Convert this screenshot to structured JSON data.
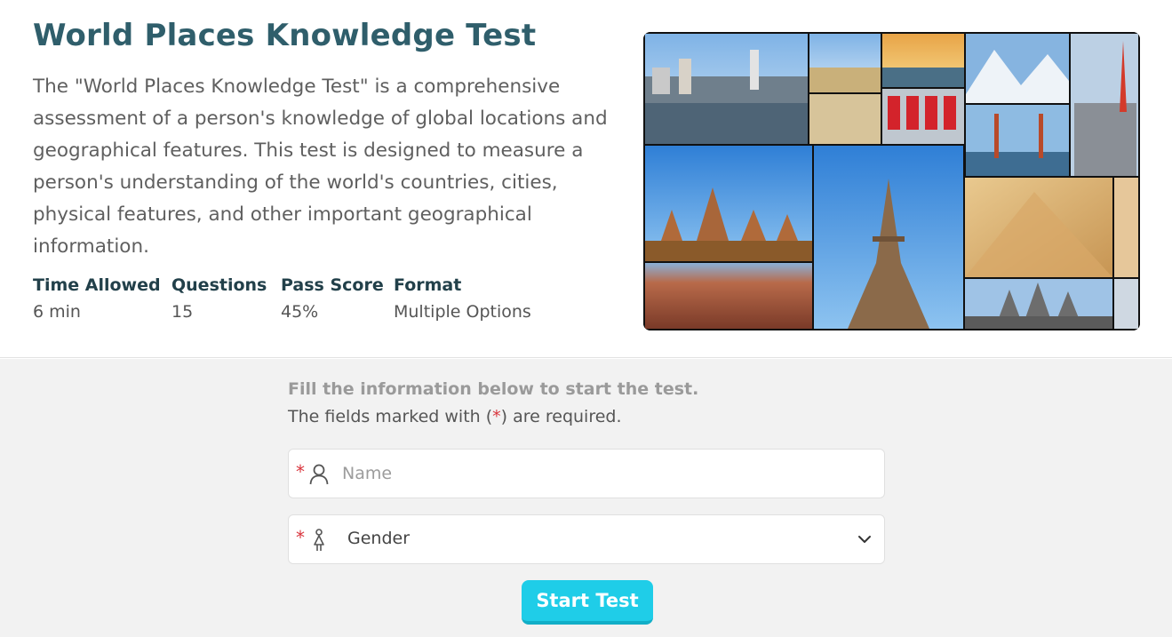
{
  "header": {
    "title": "World Places Knowledge Test",
    "description": "The \"World Places Knowledge Test\" is a comprehensive assessment of a person's knowledge of global locations and geographical features. This test is designed to measure a person's understanding of the world's countries, cities, physical features, and other important geographical information."
  },
  "stats": [
    {
      "label": "Time Allowed",
      "value": "6 min"
    },
    {
      "label": "Questions",
      "value": "15"
    },
    {
      "label": "Pass Score",
      "value": "45%"
    },
    {
      "label": "Format",
      "value": "Multiple Options"
    }
  ],
  "form": {
    "intro": "Fill the information below to start the test.",
    "required_note_before": "The fields marked with (",
    "required_star": "*",
    "required_note_after": ") are required.",
    "name_placeholder": "Name",
    "name_value": "",
    "gender_selected": "Gender",
    "start_button": "Start Test"
  },
  "icons": [
    "user-icon",
    "female-figure-icon",
    "chevron-down-icon"
  ],
  "colors": {
    "title": "#2f5e6b",
    "accent_button": "#1fcde8",
    "required_star": "#d9363e",
    "form_background": "#f2f2f2"
  }
}
